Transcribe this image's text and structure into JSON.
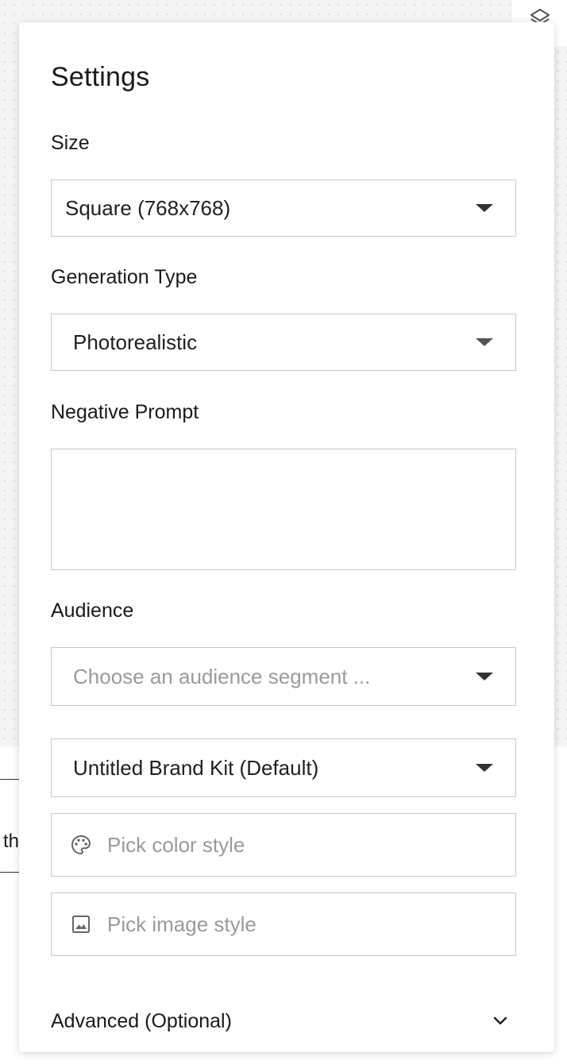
{
  "panel": {
    "title": "Settings"
  },
  "size": {
    "label": "Size",
    "selected": "Square (768x768)"
  },
  "generation_type": {
    "label": "Generation Type",
    "selected": "Photorealistic"
  },
  "negative_prompt": {
    "label": "Negative Prompt",
    "value": ""
  },
  "audience": {
    "label": "Audience",
    "placeholder": "Choose an audience segment ..."
  },
  "brand_kit": {
    "selected": "Untitled Brand Kit (Default)"
  },
  "color_style": {
    "placeholder": "Pick color style",
    "icon": "palette-icon"
  },
  "image_style": {
    "placeholder": "Pick image style",
    "icon": "image-icon"
  },
  "advanced": {
    "label": "Advanced (Optional)"
  },
  "background": {
    "partial_text": "th"
  },
  "colors": {
    "border": "#c8c8c8",
    "placeholder": "#9a9a9a",
    "text": "#1a1a1a"
  }
}
